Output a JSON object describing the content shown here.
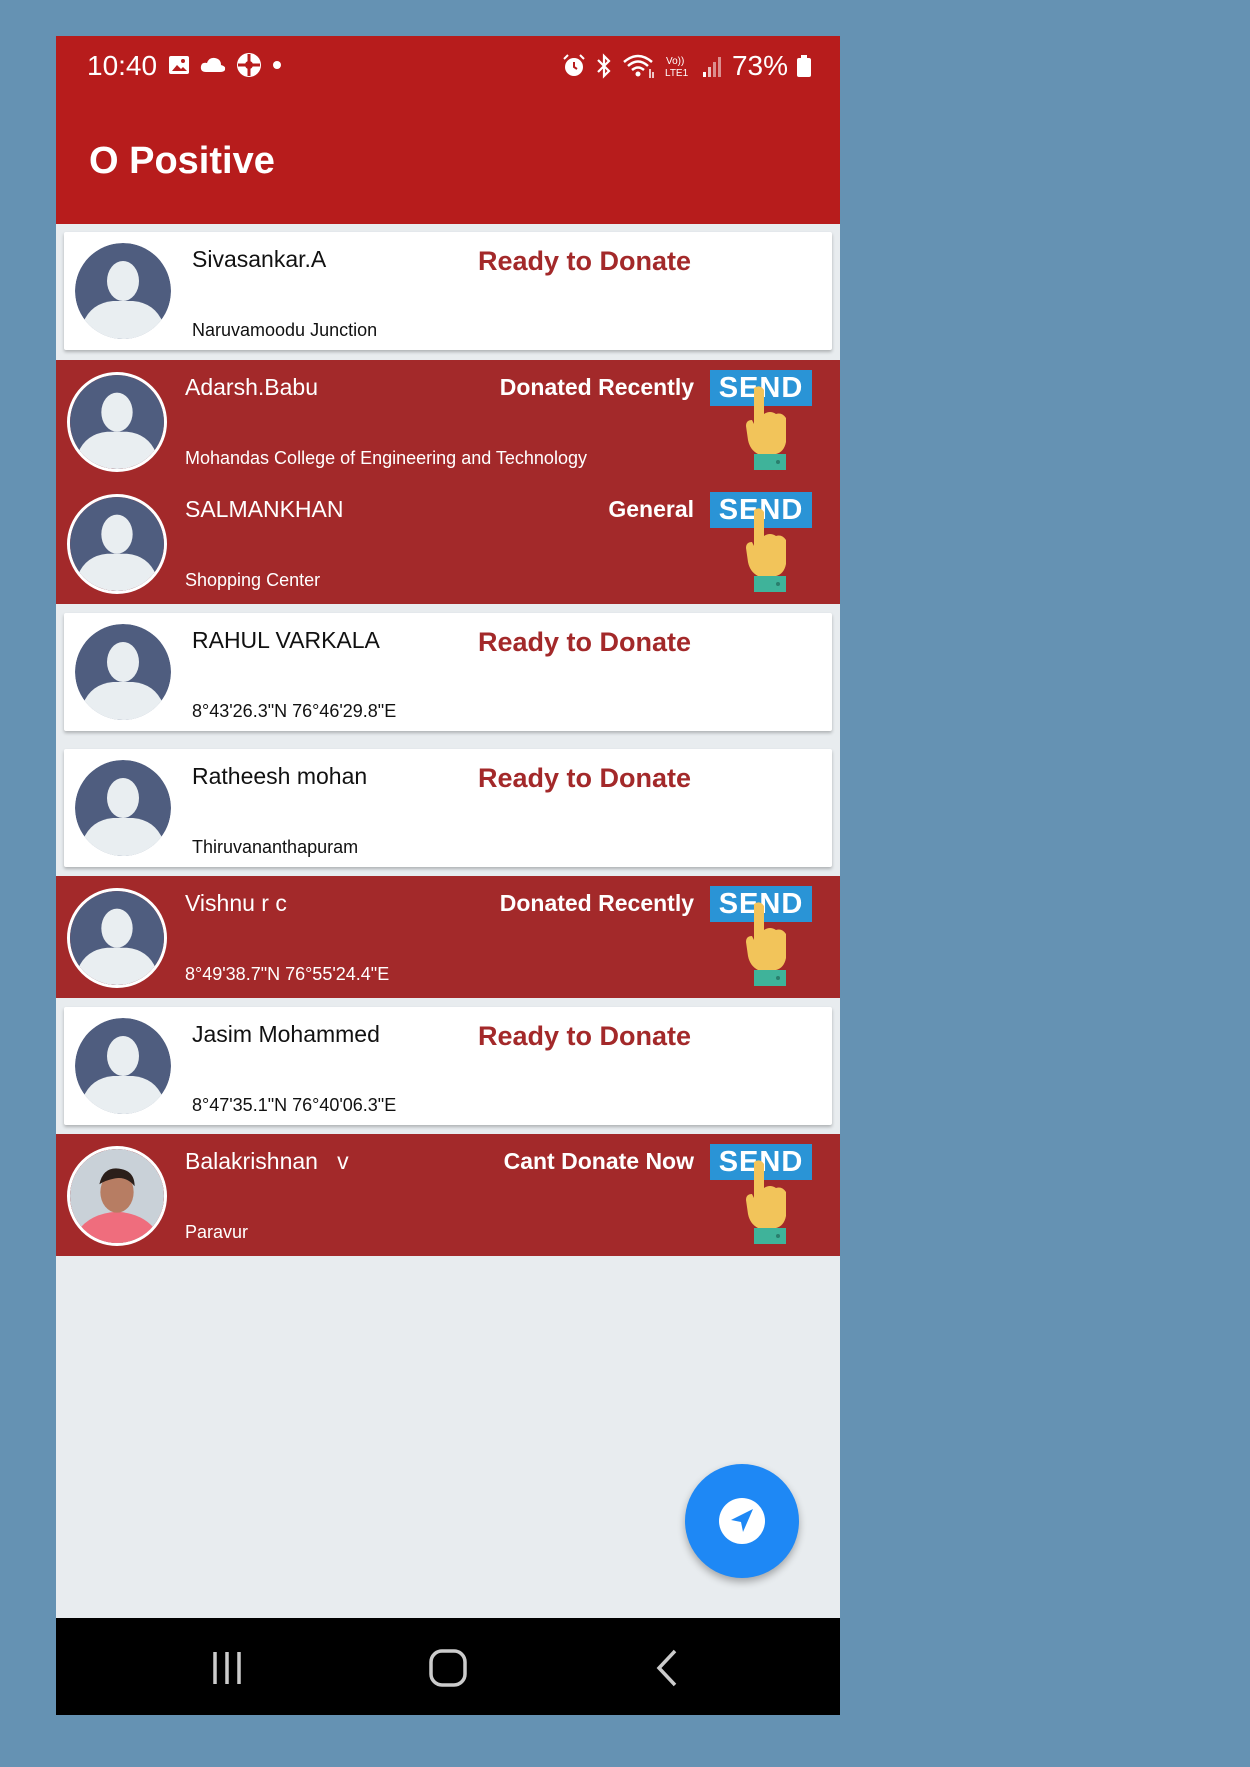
{
  "status_bar": {
    "time": "10:40",
    "battery": "73%"
  },
  "app_bar": {
    "title": "O Positive"
  },
  "donors": [
    {
      "name": "Sivasankar.A",
      "place": "Naruvamoodu Junction",
      "status": "Ready to Donate"
    },
    {
      "name": "Adarsh.Babu",
      "place": "Mohandas College of Engineering and Technology",
      "status": "Donated Recently",
      "send": "SEND"
    },
    {
      "name": "SALMANKHAN",
      "place": "Shopping Center",
      "status": "General",
      "send": "SEND"
    },
    {
      "name": "RAHUL VARKALA",
      "place": "8°43'26.3\"N 76°46'29.8\"E",
      "status": "Ready to Donate"
    },
    {
      "name": "Ratheesh mohan",
      "place": "Thiruvananthapuram",
      "status": "Ready to Donate"
    },
    {
      "name": "Vishnu r c",
      "place": "8°49'38.7\"N 76°55'24.4\"E",
      "status": "Donated Recently",
      "send": "SEND"
    },
    {
      "name": "Jasim Mohammed",
      "place": "8°47'35.1\"N 76°40'06.3\"E",
      "status": "Ready to Donate"
    },
    {
      "name": "Balakrishnan   v",
      "place": "Paravur",
      "status": "Cant Donate Now",
      "send": "SEND"
    }
  ],
  "colors": {
    "primary": "#b71c1c",
    "row_red": "#a3292a",
    "send_blue": "#2a94d6",
    "fab": "#1e88f5"
  },
  "icons": {
    "fab": "navigation-arrow-icon"
  }
}
